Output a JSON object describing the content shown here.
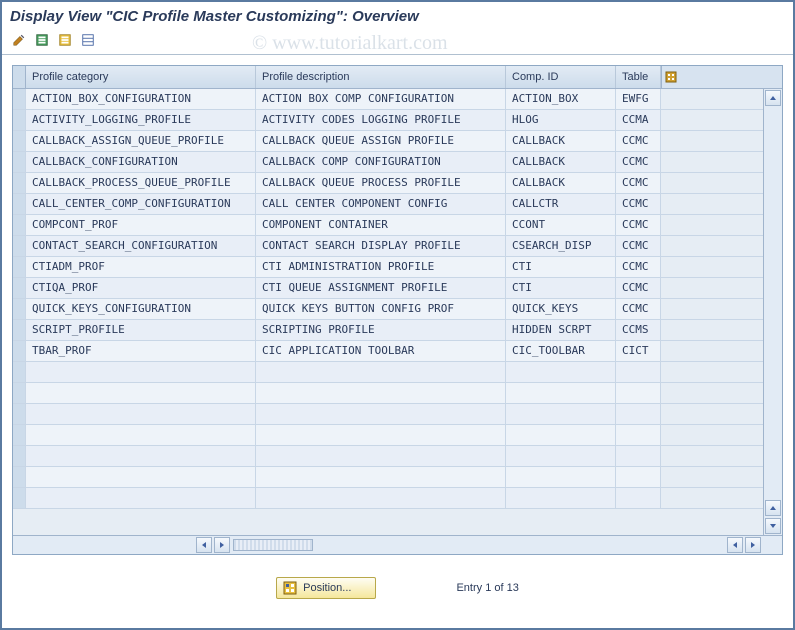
{
  "title": "Display View \"CIC Profile Master Customizing\": Overview",
  "watermark": "© www.tutorialkart.com",
  "toolbar": {
    "edit_icon": "pencil-icon",
    "expand_icon": "expand-icon",
    "collapse_icon": "collapse-icon",
    "layout_icon": "layout-icon"
  },
  "columns": {
    "c0": "Profile category",
    "c1": "Profile description",
    "c2": "Comp. ID",
    "c3": "Table"
  },
  "rows": [
    {
      "cat": "ACTION_BOX_CONFIGURATION",
      "desc": "ACTION BOX COMP CONFIGURATION",
      "comp": "ACTION_BOX",
      "tbl": "EWFG"
    },
    {
      "cat": "ACTIVITY_LOGGING_PROFILE",
      "desc": "ACTIVITY CODES LOGGING PROFILE",
      "comp": "HLOG",
      "tbl": "CCMA"
    },
    {
      "cat": "CALLBACK_ASSIGN_QUEUE_PROFILE",
      "desc": "CALLBACK QUEUE ASSIGN PROFILE",
      "comp": "CALLBACK",
      "tbl": "CCMC"
    },
    {
      "cat": "CALLBACK_CONFIGURATION",
      "desc": "CALLBACK COMP CONFIGURATION",
      "comp": "CALLBACK",
      "tbl": "CCMC"
    },
    {
      "cat": "CALLBACK_PROCESS_QUEUE_PROFILE",
      "desc": "CALLBACK QUEUE PROCESS PROFILE",
      "comp": "CALLBACK",
      "tbl": "CCMC"
    },
    {
      "cat": "CALL_CENTER_COMP_CONFIGURATION",
      "desc": "CALL CENTER COMPONENT CONFIG",
      "comp": "CALLCTR",
      "tbl": "CCMC"
    },
    {
      "cat": "COMPCONT_PROF",
      "desc": "COMPONENT CONTAINER",
      "comp": "CCONT",
      "tbl": "CCMC"
    },
    {
      "cat": "CONTACT_SEARCH_CONFIGURATION",
      "desc": "CONTACT SEARCH DISPLAY PROFILE",
      "comp": "CSEARCH_DISP",
      "tbl": "CCMC"
    },
    {
      "cat": "CTIADM_PROF",
      "desc": "CTI ADMINISTRATION PROFILE",
      "comp": "CTI",
      "tbl": "CCMC"
    },
    {
      "cat": "CTIQA_PROF",
      "desc": "CTI QUEUE ASSIGNMENT PROFILE",
      "comp": "CTI",
      "tbl": "CCMC"
    },
    {
      "cat": "QUICK_KEYS_CONFIGURATION",
      "desc": "QUICK KEYS BUTTON CONFIG PROF",
      "comp": "QUICK_KEYS",
      "tbl": "CCMC"
    },
    {
      "cat": "SCRIPT_PROFILE",
      "desc": "SCRIPTING PROFILE",
      "comp": "HIDDEN SCRPT",
      "tbl": "CCMS"
    },
    {
      "cat": "TBAR_PROF",
      "desc": "CIC APPLICATION TOOLBAR",
      "comp": "CIC_TOOLBAR",
      "tbl": "CICT"
    },
    {
      "cat": "",
      "desc": "",
      "comp": "",
      "tbl": ""
    },
    {
      "cat": "",
      "desc": "",
      "comp": "",
      "tbl": ""
    },
    {
      "cat": "",
      "desc": "",
      "comp": "",
      "tbl": ""
    },
    {
      "cat": "",
      "desc": "",
      "comp": "",
      "tbl": ""
    },
    {
      "cat": "",
      "desc": "",
      "comp": "",
      "tbl": ""
    },
    {
      "cat": "",
      "desc": "",
      "comp": "",
      "tbl": ""
    },
    {
      "cat": "",
      "desc": "",
      "comp": "",
      "tbl": ""
    }
  ],
  "footer": {
    "position_label": "Position...",
    "entry_label": "Entry 1 of 13"
  }
}
